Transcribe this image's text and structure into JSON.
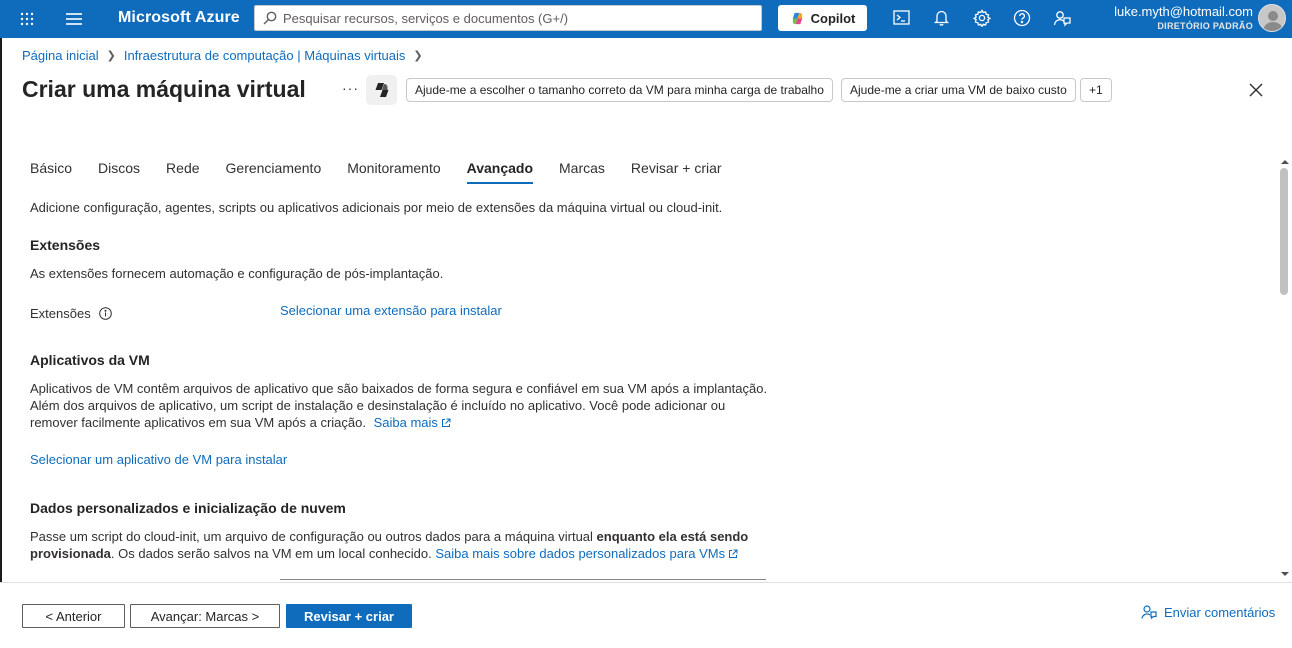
{
  "topbar": {
    "brand": "Microsoft Azure",
    "search_placeholder": "Pesquisar recursos, serviços e documentos (G+/)",
    "copilot_label": "Copilot",
    "user_email": "luke.myth@hotmail.com",
    "user_directory": "DIRETÓRIO PADRÃO"
  },
  "breadcrumb": {
    "items": [
      "Página inicial",
      "Infraestrutura de computação | Máquinas virtuais"
    ]
  },
  "header": {
    "title": "Criar uma máquina virtual",
    "more": "···",
    "chips": [
      "Ajude-me a escolher o tamanho correto da VM para minha carga de trabalho",
      "Ajude-me a criar uma VM de baixo custo",
      "+1"
    ]
  },
  "tabs": [
    {
      "label": "Básico",
      "active": false
    },
    {
      "label": "Discos",
      "active": false
    },
    {
      "label": "Rede",
      "active": false
    },
    {
      "label": "Gerenciamento",
      "active": false
    },
    {
      "label": "Monitoramento",
      "active": false
    },
    {
      "label": "Avançado",
      "active": true
    },
    {
      "label": "Marcas",
      "active": false
    },
    {
      "label": "Revisar + criar",
      "active": false
    }
  ],
  "content": {
    "intro": "Adicione configuração, agentes, scripts ou aplicativos adicionais por meio de extensões da máquina virtual ou cloud-init.",
    "extensions": {
      "heading": "Extensões",
      "description": "As extensões fornecem automação e configuração de pós-implantação.",
      "field_label": "Extensões",
      "link": "Selecionar uma extensão para instalar"
    },
    "vm_apps": {
      "heading": "Aplicativos da VM",
      "line1": "Aplicativos de VM contêm arquivos de aplicativo que são baixados de forma segura e confiável em sua VM após a implantação.",
      "line2": "Além dos arquivos de aplicativo, um script de instalação e desinstalação é incluído no aplicativo. Você pode adicionar ou",
      "line3": "remover facilmente aplicativos em sua VM após a criação.",
      "learn_more": "Saiba mais",
      "link": "Selecionar um aplicativo de VM para instalar"
    },
    "custom_data": {
      "heading": "Dados personalizados e inicialização de nuvem",
      "line1_start": "Passe um script do cloud-init, um arquivo de configuração ou outros dados para a máquina virtual ",
      "line1_bold": "enquanto ela está sendo",
      "line2_bold": "provisionada",
      "line2_rest": ". Os dados serão salvos na VM em um local conhecido. ",
      "learn_more": "Saiba mais sobre dados personalizados para VMs"
    }
  },
  "footer": {
    "prev": "< Anterior",
    "next": "Avançar: Marcas >",
    "review": "Revisar + criar",
    "feedback": "Enviar comentários"
  },
  "colors": {
    "brand_blue": "#0f6cbd",
    "text": "#323130"
  }
}
